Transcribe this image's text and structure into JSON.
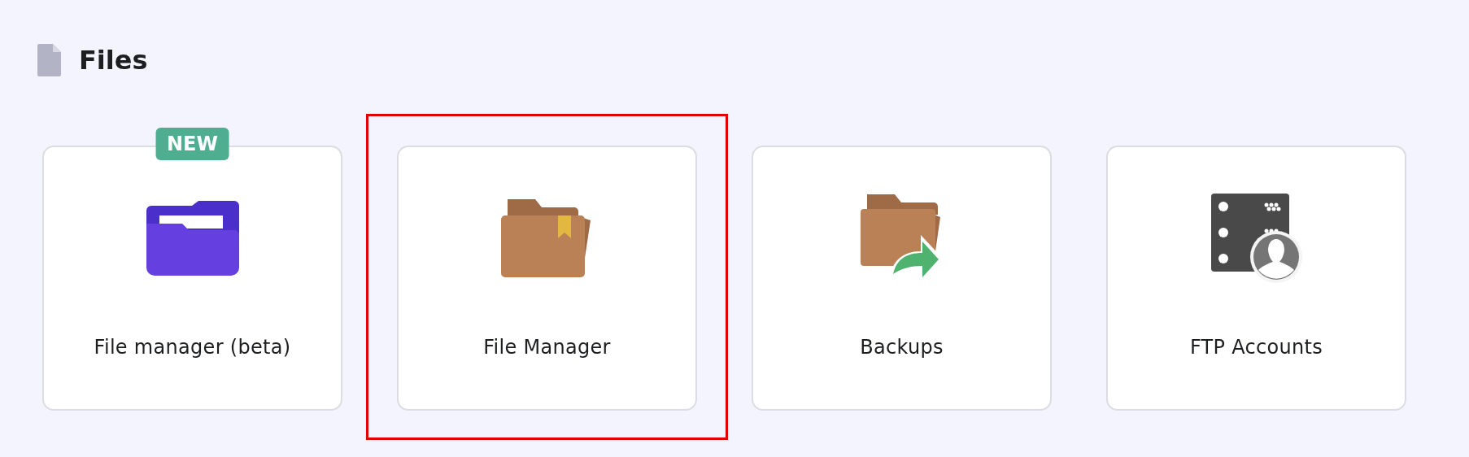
{
  "section": {
    "title": "Files"
  },
  "tiles": [
    {
      "label": "File manager (beta)",
      "kind": "beta-folder",
      "badge": "NEW",
      "highlighted": false
    },
    {
      "label": "File Manager",
      "kind": "folder",
      "highlighted": true
    },
    {
      "label": "Backups",
      "kind": "backup",
      "highlighted": false
    },
    {
      "label": "FTP Accounts",
      "kind": "ftp",
      "highlighted": false
    }
  ]
}
